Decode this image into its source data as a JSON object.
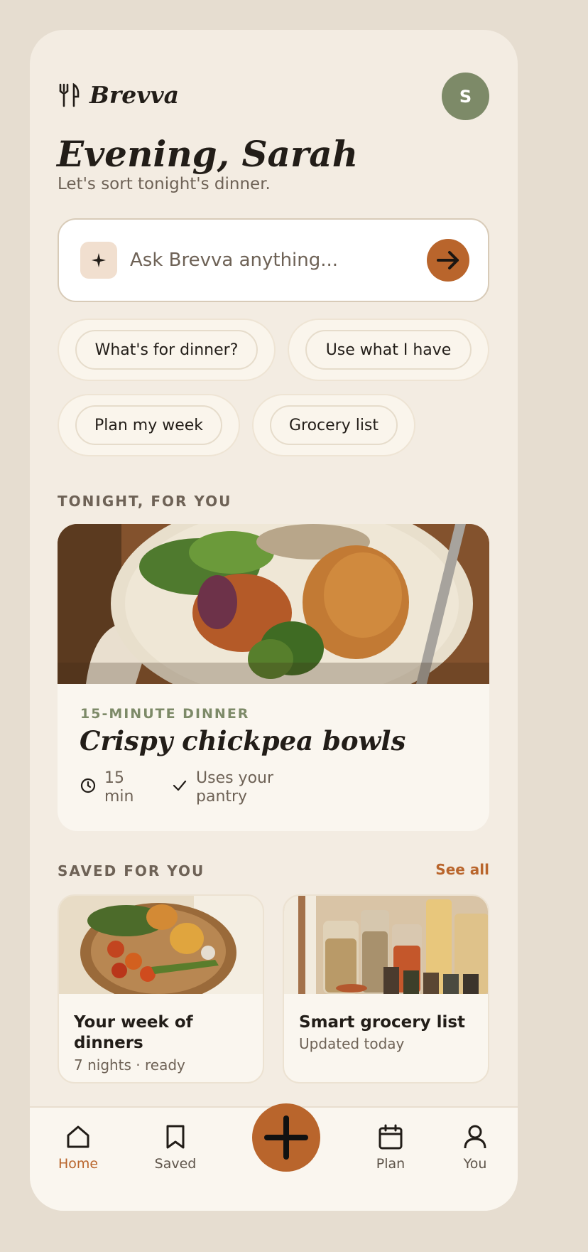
{
  "app": {
    "name": "Brevva",
    "avatar_initial": "S"
  },
  "greeting": {
    "title": "Evening, Sarah",
    "subtitle": "Let's sort tonight's dinner."
  },
  "ask": {
    "placeholder": "Ask Brevva anything..."
  },
  "chips": [
    "What's for dinner?",
    "Use what I have",
    "Plan my week",
    "Grocery list"
  ],
  "tonight": {
    "section_label": "TONIGHT, FOR YOU",
    "kicker": "15-MINUTE DINNER",
    "title": "Crispy chickpea bowls",
    "time_line1": "15",
    "time_line2": "min",
    "pantry_line1": "Uses your",
    "pantry_line2": "pantry"
  },
  "saved": {
    "section_label": "SAVED FOR YOU",
    "see_all": "See all",
    "cards": [
      {
        "title": "Your week of dinners",
        "subtitle": "7 nights · ready"
      },
      {
        "title": "Smart grocery list",
        "subtitle": "Updated today"
      }
    ]
  },
  "nav": {
    "home": "Home",
    "saved": "Saved",
    "plan": "Plan",
    "you": "You",
    "active": "home"
  },
  "colors": {
    "accent": "#b9652c",
    "sage": "#7d8a68",
    "background": "#f3ece2",
    "outer": "#e6ddd0"
  }
}
